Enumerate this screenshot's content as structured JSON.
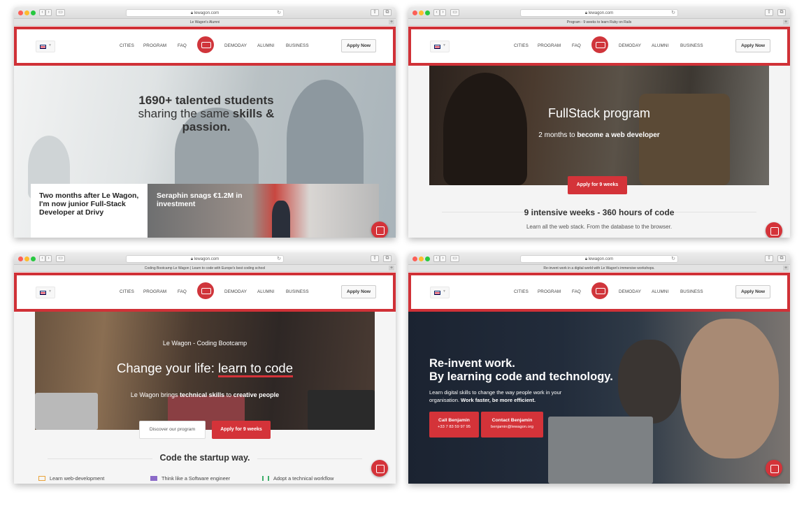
{
  "nav": {
    "links": [
      "CITIES",
      "PROGRAM",
      "FAQ",
      "DEMODAY",
      "ALUMNI",
      "BUSINESS"
    ],
    "apply": "Apply Now",
    "language": "EN"
  },
  "browser": {
    "url": "lewagon.com",
    "icons": [
      "back-icon",
      "forward-icon",
      "sidebar-icon",
      "lock-icon",
      "reload-icon",
      "share-icon",
      "tabs-icon",
      "new-tab-icon"
    ]
  },
  "colors": {
    "brand_red": "#d43339",
    "highlight_border": "#d03137"
  },
  "windows": [
    {
      "tab_title": "Le Wagon's Alumni",
      "hero_line1": "1690+ talented students",
      "hero_line2": "sharing the same",
      "hero_bold1": "skills &",
      "hero_bold2": "passion.",
      "card1": "Two months after Le Wagon, I'm now junior Full-Stack Developer at Drivy",
      "card2": "Seraphin snags €1.2M in investment"
    },
    {
      "tab_title": "Program - 9 weeks to learn Ruby on Rails",
      "hero_title": "FullStack program",
      "hero_sub_plain": "2 months to ",
      "hero_sub_bold": "become a web developer",
      "cta": "Apply for 9 weeks",
      "heading": "9 intensive weeks - 360 hours of code",
      "paragraph": "Learn all the web stack. From the database to the browser."
    },
    {
      "tab_title": "Coding Bootcamp Le Wagon | Learn to code with Europe's best coding school",
      "kicker": "Le Wagon - Coding Bootcamp",
      "title_plain": "Change your life: ",
      "title_underlined": "learn to code",
      "sub_1": "Le Wagon brings ",
      "sub_2": "technical skills",
      "sub_3": " to ",
      "sub_4": "creative people",
      "btn_discover": "Discover our program",
      "btn_apply": "Apply for 9 weeks",
      "heading": "Code the startup way.",
      "features": [
        "Learn web-development",
        "Think like a Software engineer",
        "Adopt a technical workflow"
      ]
    },
    {
      "tab_title": "Re-invent work in a digital world with Le Wagon's immersive workshops.",
      "title_1": "Re-invent work.",
      "title_2": "By learning code and technology.",
      "para_plain": "Learn digital skills to change the way people work in your organisation.",
      "para_bold": "Work faster, be more efficient.",
      "btn1_title": "Call Benjamin",
      "btn1_sub": "+33 7 83 59 97 95",
      "btn2_title": "Contact Benjamin",
      "btn2_sub": "benjamin@lewagon.org"
    }
  ]
}
